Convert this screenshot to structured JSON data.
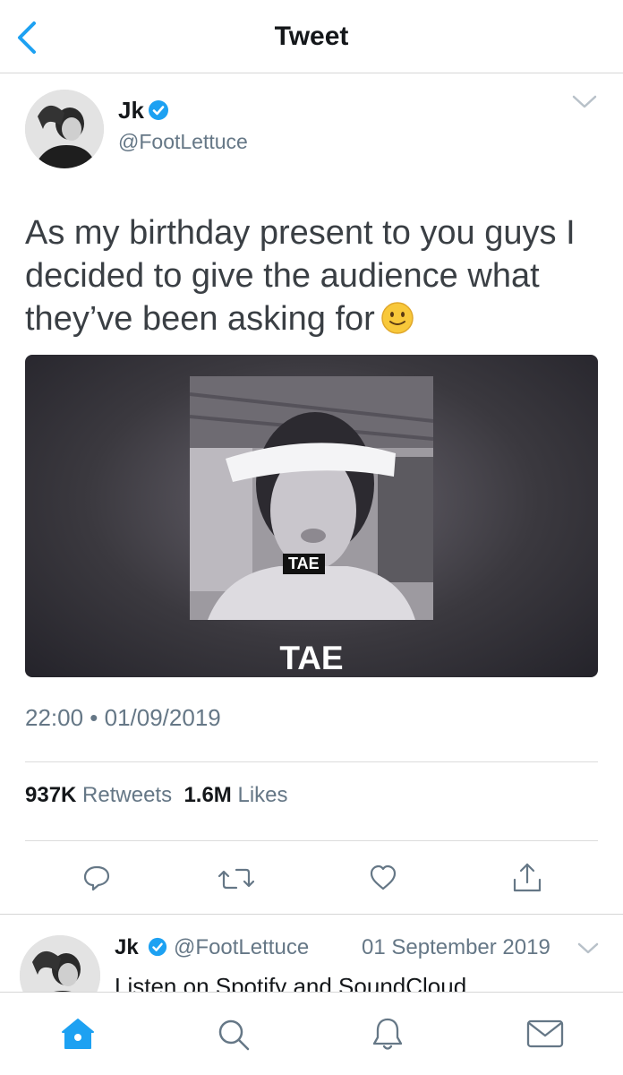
{
  "nav": {
    "title": "Tweet",
    "back_icon": "chevron-left-icon"
  },
  "tweet": {
    "author_name": "Jk",
    "author_handle": "@FootLettuce",
    "text": "As my birthday present to you guys I decided to give the audience what they’ve been asking for",
    "emoji": "slightly-smiling-face",
    "media": {
      "caption_small": "TAE",
      "caption_big": "TAE"
    },
    "timestamp": "22:00 • 01/09/2019",
    "retweets_count": "937K",
    "retweets_label": "Retweets",
    "likes_count": "1.6M",
    "likes_label": "Likes"
  },
  "reply": {
    "author_name": "Jk",
    "author_handle": "@FootLettuce",
    "date": "01 September 2019",
    "text": "Listen on Spotify and SoundCloud"
  },
  "colors": {
    "accent": "#1da1f2",
    "secondary_text": "#657786",
    "icon_gray": "#657786"
  }
}
